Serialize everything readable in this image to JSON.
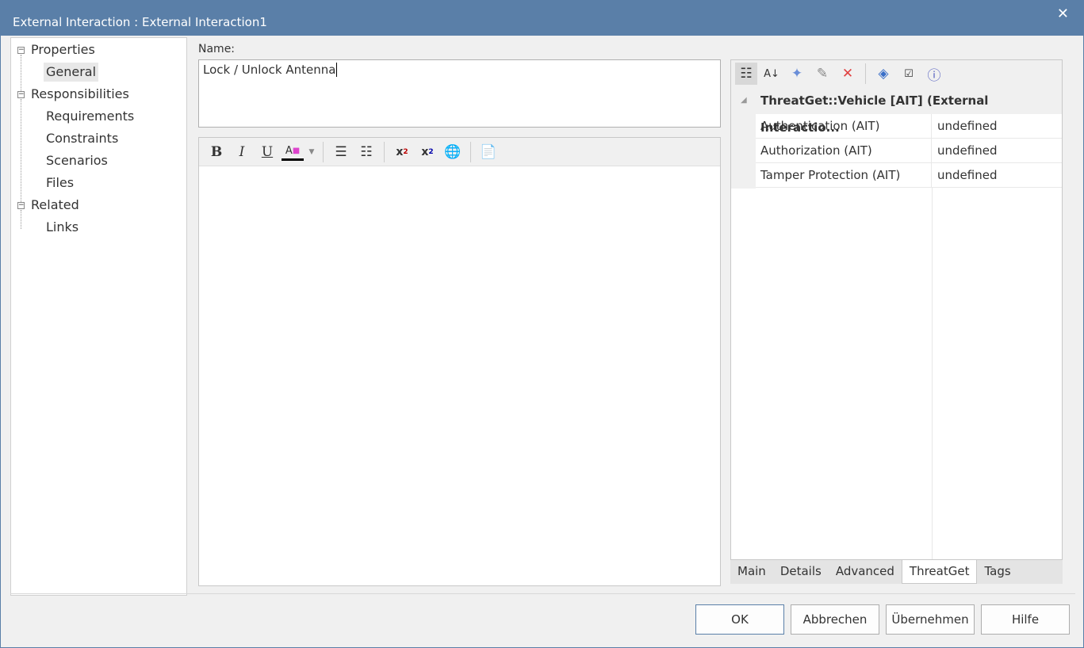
{
  "window": {
    "title": "External Interaction : External Interaction1",
    "close_icon": "close-icon"
  },
  "tree": [
    {
      "label": "Properties",
      "level": 0
    },
    {
      "label": "General",
      "level": 1,
      "selected": true
    },
    {
      "label": "Responsibilities",
      "level": 0
    },
    {
      "label": "Requirements",
      "level": 1
    },
    {
      "label": "Constraints",
      "level": 1
    },
    {
      "label": "Scenarios",
      "level": 1
    },
    {
      "label": "Files",
      "level": 1
    },
    {
      "label": "Related",
      "level": 0
    },
    {
      "label": "Links",
      "level": 1
    }
  ],
  "name": {
    "label": "Name:",
    "value": "Lock / Unlock Antenna"
  },
  "editor_toolbar": [
    "bold-icon",
    "italic-icon",
    "underline-icon",
    "font-color-icon",
    "bullet-list-icon",
    "numbered-list-icon",
    "superscript-icon",
    "subscript-icon",
    "hyperlink-icon",
    "document-icon"
  ],
  "grid": {
    "group": "ThreatGet::Vehicle [AIT] (External Interactio...",
    "rows": [
      {
        "key": "Authentication (AIT)",
        "value": "undefined"
      },
      {
        "key": "Authorization (AIT)",
        "value": "undefined"
      },
      {
        "key": "Tamper Protection (AIT)",
        "value": "undefined"
      }
    ]
  },
  "tabs": [
    "Main",
    "Details",
    "Advanced",
    "ThreatGet",
    "Tags"
  ],
  "active_tab": "ThreatGet",
  "buttons": {
    "ok": "OK",
    "cancel": "Abbrechen",
    "apply": "Übernehmen",
    "help": "Hilfe"
  }
}
